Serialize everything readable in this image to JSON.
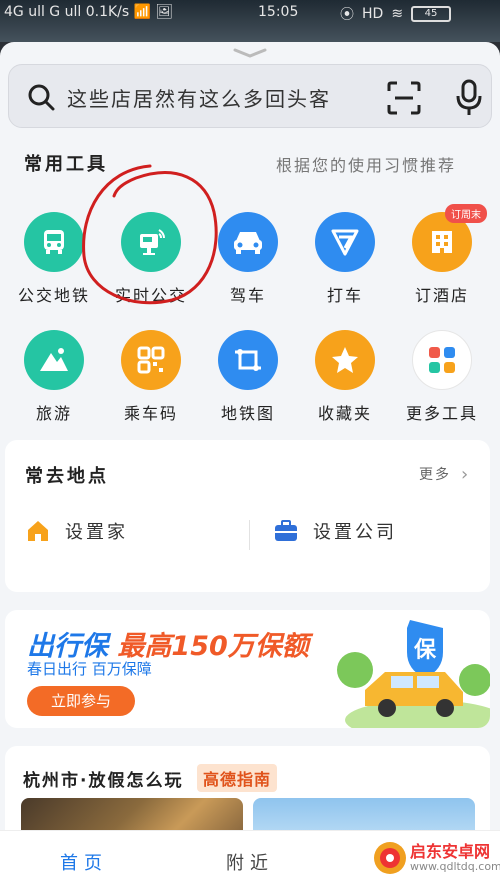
{
  "status_bar": {
    "left": "4G ull G ull 0.1K/s 📶 🖼",
    "time": "15:05",
    "hd": "HD",
    "battery": "45"
  },
  "search": {
    "placeholder": "这些店居然有这么多回头客"
  },
  "tools": {
    "title": "常用工具",
    "hint": "根据您的使用习惯推荐",
    "items": [
      {
        "label": "公交地铁",
        "icon": "bus-icon",
        "color": "#25c5a3"
      },
      {
        "label": "实时公交",
        "icon": "realtime-bus-icon",
        "color": "#25c5a3"
      },
      {
        "label": "驾车",
        "icon": "car-icon",
        "color": "#2f8cf0"
      },
      {
        "label": "打车",
        "icon": "taxi-icon",
        "color": "#2f8cf0"
      },
      {
        "label": "订酒店",
        "icon": "hotel-icon",
        "color": "#f7a21b",
        "badge": "订周末"
      },
      {
        "label": "旅游",
        "icon": "travel-icon",
        "color": "#25c5a3"
      },
      {
        "label": "乘车码",
        "icon": "ride-code-icon",
        "color": "#f7a21b"
      },
      {
        "label": "地铁图",
        "icon": "subway-map-icon",
        "color": "#2f8cf0"
      },
      {
        "label": "收藏夹",
        "icon": "star-icon",
        "color": "#f7a21b"
      },
      {
        "label": "更多工具",
        "icon": "more-tools-icon",
        "color": "#ffffff"
      }
    ]
  },
  "places": {
    "title": "常去地点",
    "more": "更多",
    "home": "设置家",
    "company": "设置公司"
  },
  "promo": {
    "brand": "出行保",
    "headline": "最高150万保额",
    "sub": "春日出行 百万保障",
    "button": "立即参与",
    "shield": "保"
  },
  "guide": {
    "title": "杭州市·放假怎么玩",
    "tag": "高德指南"
  },
  "tabbar": {
    "home": "首页",
    "nearby": "附近"
  },
  "watermark": {
    "name": "启东安卓网",
    "url": "www.qdltdq.com"
  }
}
